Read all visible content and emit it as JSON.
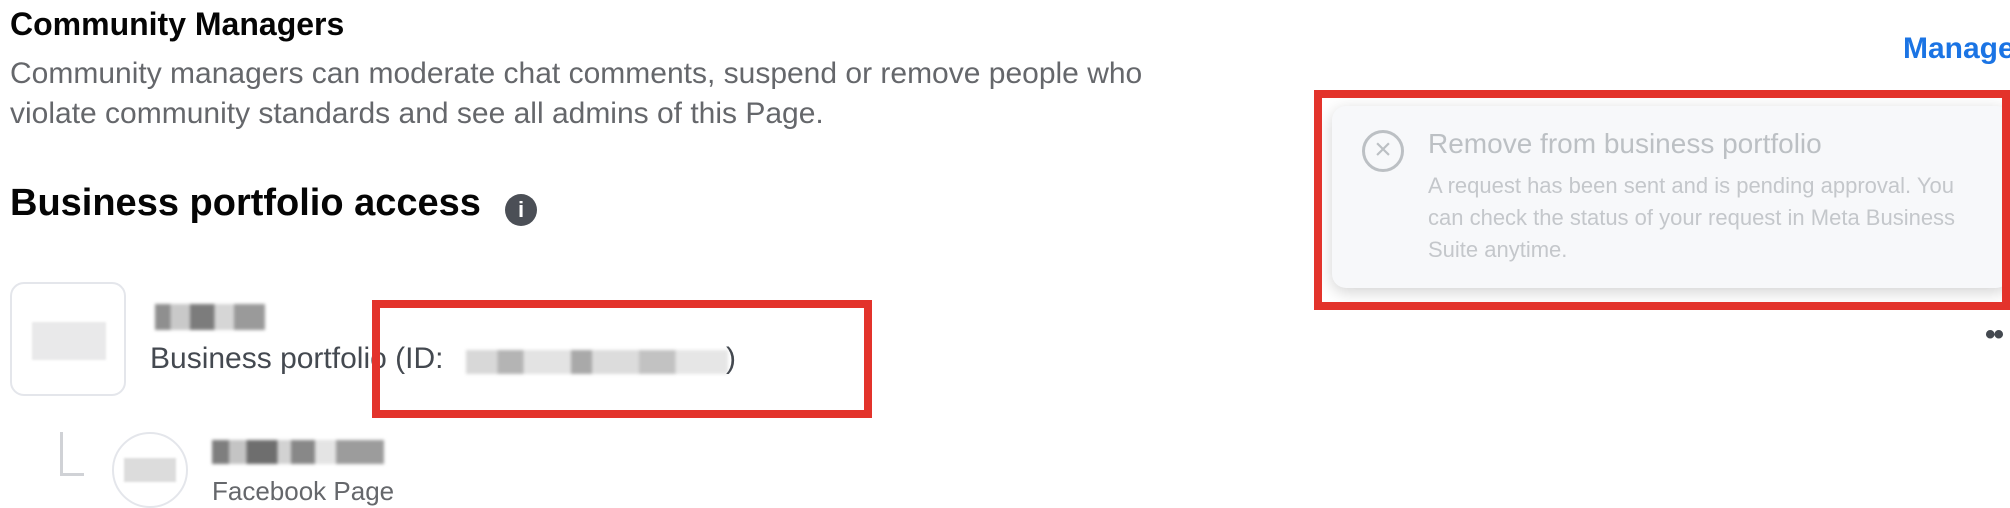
{
  "community_managers": {
    "title": "Community Managers",
    "description": "Community managers can moderate chat comments, suspend or remove people who violate community standards and see all admins of this Page.",
    "manage_label": "Manage"
  },
  "business_access": {
    "title": "Business portfolio access",
    "info_icon": "info-icon",
    "portfolio": {
      "type_prefix": "Business portfolio (ID:",
      "type_suffix": ")"
    },
    "page_item": {
      "type": "Facebook Page"
    }
  },
  "toast": {
    "icon": "circle-x-icon",
    "title": "Remove from business portfolio",
    "message": "A request has been sent and is pending approval. You can check the status of your request in Meta Business Suite anytime."
  },
  "colors": {
    "accent": "#1b74e4",
    "annotation": "#e3332b"
  }
}
